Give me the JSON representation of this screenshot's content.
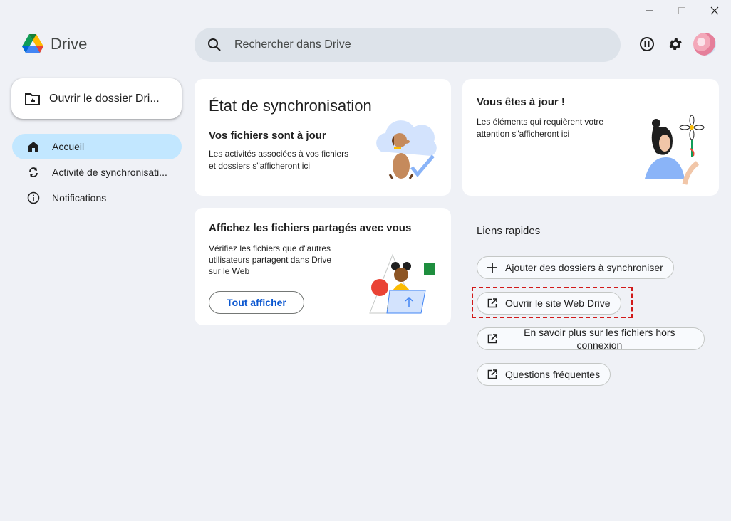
{
  "app": {
    "name": "Drive"
  },
  "search": {
    "placeholder": "Rechercher dans Drive"
  },
  "sidebar": {
    "open_folder_label": "Ouvrir le dossier Dri...",
    "items": [
      {
        "label": "Accueil"
      },
      {
        "label": "Activité de synchronisati..."
      },
      {
        "label": "Notifications"
      }
    ]
  },
  "sync_card": {
    "title": "État de synchronisation",
    "subtitle": "Vos fichiers sont à jour",
    "text_line1": "Les activités associées à vos fichiers",
    "text_line2": "et dossiers s\"afficheront ici"
  },
  "uptodate_card": {
    "title": "Vous êtes à jour !",
    "text_line1": "Les éléments qui requièrent votre",
    "text_line2": "attention s\"afficheront ici"
  },
  "shared_card": {
    "title": "Affichez les fichiers partagés avec vous",
    "text_line1": "Vérifiez les fichiers que d\"autres",
    "text_line2": "utilisateurs partagent dans Drive",
    "text_line3": "sur le Web",
    "button_label": "Tout afficher"
  },
  "quick_links": {
    "title": "Liens rapides",
    "items": [
      {
        "label": "Ajouter des dossiers à synchroniser",
        "icon": "plus-icon"
      },
      {
        "label": "Ouvrir le site Web Drive",
        "icon": "open-external-icon"
      },
      {
        "label": "En savoir plus sur les fichiers hors connexion",
        "icon": "open-external-icon"
      },
      {
        "label": "Questions fréquentes",
        "icon": "open-external-icon"
      }
    ]
  },
  "colors": {
    "background": "#eff1f6",
    "active_nav": "#c2e7ff",
    "search_bg": "#dde3ea",
    "accent_blue": "#0b57d0",
    "highlight_red": "#d11a1a"
  }
}
